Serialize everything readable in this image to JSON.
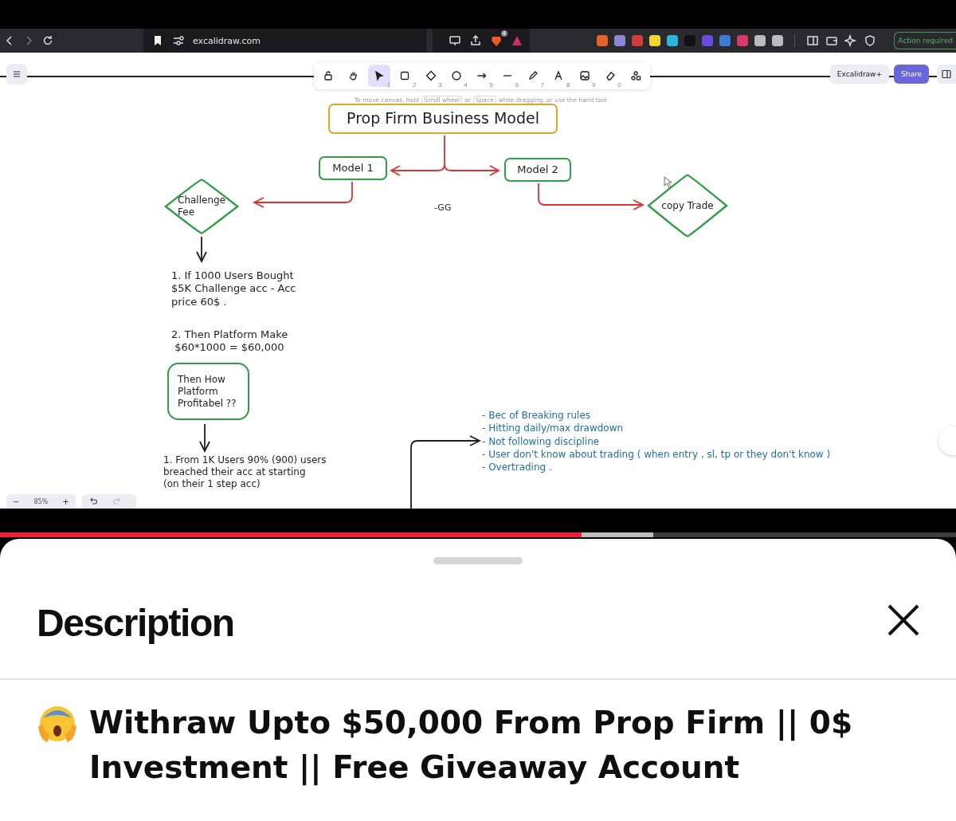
{
  "browser": {
    "url": "excalidraw.com",
    "shield_badge": "4",
    "action_button": "Action required"
  },
  "toolbar": {
    "tools": [
      {
        "kind": "lock",
        "selected": false
      },
      {
        "kind": "hand",
        "selected": false
      },
      {
        "kind": "select",
        "shortcut": "1",
        "selected": true
      },
      {
        "kind": "rectangle",
        "shortcut": "2",
        "selected": false
      },
      {
        "kind": "diamond",
        "shortcut": "3",
        "selected": false
      },
      {
        "kind": "ellipse",
        "shortcut": "4",
        "selected": false
      },
      {
        "kind": "arrow",
        "shortcut": "5",
        "selected": false
      },
      {
        "kind": "line",
        "shortcut": "6",
        "selected": false
      },
      {
        "kind": "pencil",
        "shortcut": "7",
        "selected": false
      },
      {
        "kind": "text",
        "shortcut": "8",
        "selected": false
      },
      {
        "kind": "image",
        "shortcut": "9",
        "selected": false
      },
      {
        "kind": "eraser",
        "shortcut": "0",
        "selected": false
      },
      {
        "kind": "shapes",
        "selected": false
      }
    ]
  },
  "top_right": {
    "buttons": [
      "Excalidraw+",
      "Share"
    ]
  },
  "hint": {
    "before": "To move canvas, hold",
    "key_1": "Scroll wheel",
    "middle": "or",
    "key_2": "Space",
    "after": "while dragging, or use the hand tool"
  },
  "diagram": {
    "nodes": [
      {
        "kind": "box",
        "color": "#e0a526",
        "text": "Prop Firm Business Model"
      },
      {
        "kind": "box",
        "color": "#2f9e44",
        "text": "Model 1"
      },
      {
        "kind": "box",
        "color": "#2f9e44",
        "text": "Model 2"
      },
      {
        "kind": "diamond",
        "color": "#2f9e44",
        "text": "Challenge\nFee"
      },
      {
        "kind": "text",
        "text": "-GG"
      },
      {
        "kind": "diamond",
        "color": "#2f9e44",
        "text": "copy Trade"
      },
      {
        "kind": "text",
        "text": "1. If 1000 Users Bought\n$5K Challenge acc - Acc\nprice 60$ ."
      },
      {
        "kind": "text",
        "text": "2. Then Platform Make\n $60*1000 = $60,000"
      },
      {
        "kind": "box",
        "color": "#2f9e44",
        "text": "Then How\nPlatform\nProfitabel ??"
      },
      {
        "kind": "text",
        "text": "1. From 1K Users 90% (900) users\nbreached their acc at starting\n(on their 1 step acc)"
      }
    ],
    "notes": [
      "- Bec of Breaking rules",
      "- Hitting daily/max drawdown",
      "- Not following discipline",
      "- User don't know about trading ( when entry , sl, tp or they don't know )",
      "- Overtrading ."
    ]
  },
  "zoom": {
    "minus": "−",
    "value": "85%",
    "plus": "+"
  },
  "video": {
    "level": 0.608
  },
  "description": {
    "heading": "Description",
    "title": "Withraw Upto $50,000 From Prop Firm ||  0$ Investment ||  Free Giveaway Account"
  }
}
